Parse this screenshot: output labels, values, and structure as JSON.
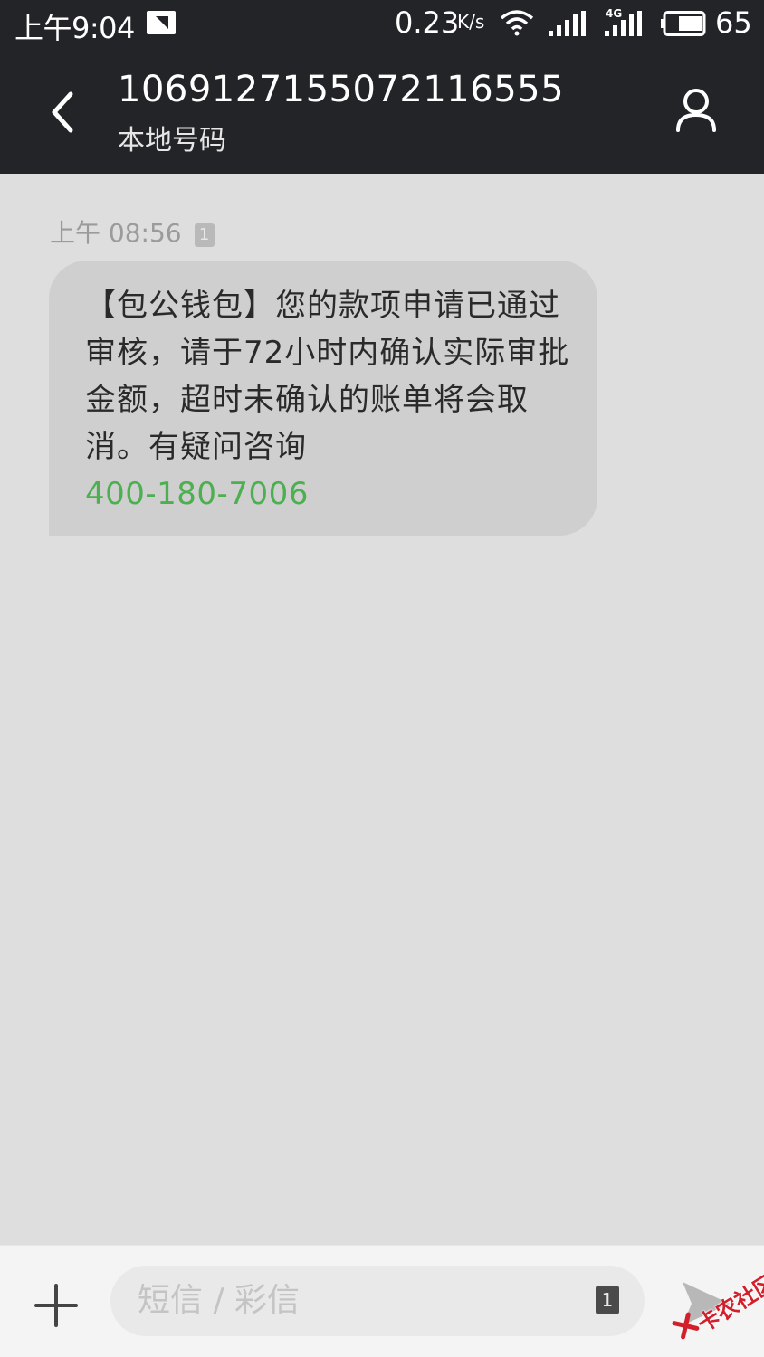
{
  "status_bar": {
    "time": "上午9:04",
    "net_speed": "0.23",
    "net_speed_unit": "K/s",
    "network_type": "4G",
    "battery_percent": "65",
    "battery_level": 0.65
  },
  "header": {
    "contact_number": "1069127155072116555",
    "contact_subtitle": "本地号码"
  },
  "conversation": {
    "messages": [
      {
        "time": "上午 08:56",
        "sim_slot": "1",
        "text": "【包公钱包】您的款项申请已通过审核，请于72小时内确认实际审批金额，超时未确认的账单将会取消。有疑问咨询",
        "phone_link": "400-180-7006"
      }
    ]
  },
  "composer": {
    "placeholder": "短信 / 彩信",
    "sim_slot": "1"
  },
  "watermark": {
    "text": "卡农社区"
  },
  "colors": {
    "header_bg": "#222427",
    "conversation_bg": "#dedede",
    "bubble_bg": "#cfcfcf",
    "link_green": "#4caf50"
  }
}
